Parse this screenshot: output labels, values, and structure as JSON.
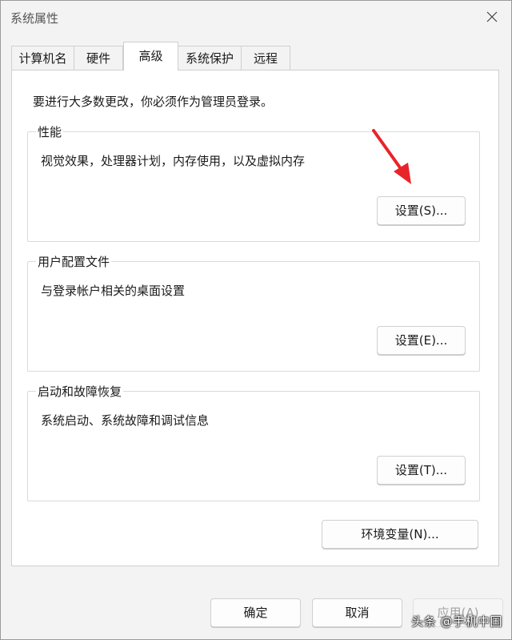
{
  "window": {
    "title": "系统属性",
    "close_icon": "close-icon"
  },
  "tabs": [
    {
      "label": "计算机名",
      "active": false
    },
    {
      "label": "硬件",
      "active": false
    },
    {
      "label": "高级",
      "active": true
    },
    {
      "label": "系统保护",
      "active": false
    },
    {
      "label": "远程",
      "active": false
    }
  ],
  "advanced": {
    "admin_note": "要进行大多数更改，你必须作为管理员登录。",
    "performance": {
      "label": "性能",
      "description": "视觉效果，处理器计划，内存使用，以及虚拟内存",
      "button": "设置(S)..."
    },
    "user_profiles": {
      "label": "用户配置文件",
      "description": "与登录帐户相关的桌面设置",
      "button": "设置(E)..."
    },
    "startup_recovery": {
      "label": "启动和故障恢复",
      "description": "系统启动、系统故障和调试信息",
      "button": "设置(T)..."
    },
    "env_button": "环境变量(N)..."
  },
  "footer": {
    "ok": "确定",
    "cancel": "取消",
    "apply": "应用(A)"
  },
  "watermark": "头条 @手机中国",
  "colors": {
    "annotation_arrow": "#e8242a",
    "chrome_bg": "#f3f3f3"
  }
}
